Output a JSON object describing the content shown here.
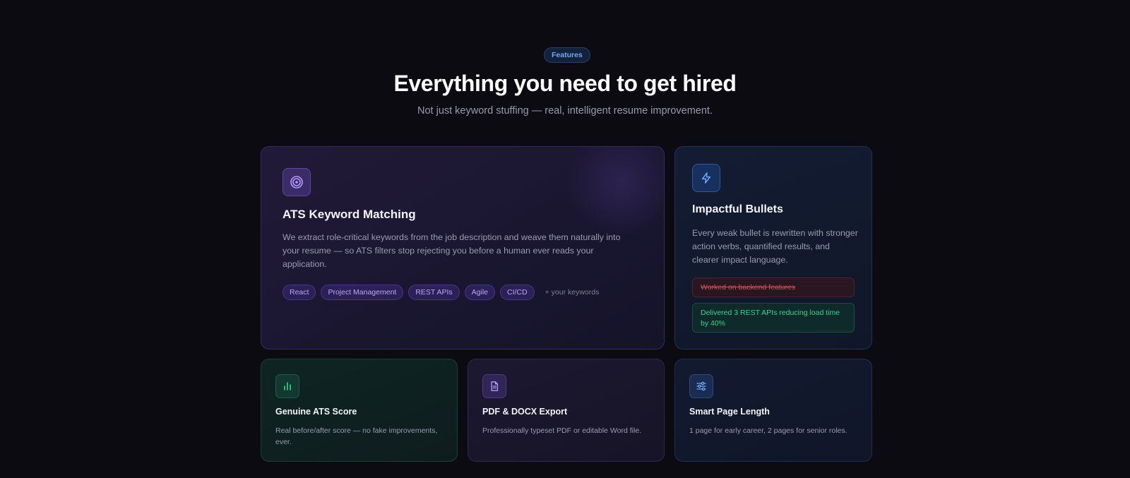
{
  "header": {
    "badge": "Features",
    "title": "Everything you need to get hired",
    "subtitle": "Not just keyword stuffing — real, intelligent resume improvement."
  },
  "cards": {
    "ats": {
      "icon": "target-icon",
      "title": "ATS Keyword Matching",
      "description": "We extract role-critical keywords from the job description and weave them naturally into your resume — so ATS filters stop rejecting you before a human ever reads your application.",
      "tags": [
        "React",
        "Project Management",
        "REST APIs",
        "Agile",
        "CI/CD"
      ],
      "extra": "+ your keywords"
    },
    "bullets": {
      "icon": "lightning-icon",
      "title": "Impactful Bullets",
      "description": "Every weak bullet is rewritten with stronger action verbs, quantified results, and clearer impact language.",
      "before": "Worked on backend features",
      "after": "Delivered 3 REST APIs reducing load time by 40%"
    },
    "score": {
      "icon": "bar-chart-icon",
      "title": "Genuine ATS Score",
      "description": "Real before/after score — no fake improvements, ever."
    },
    "export": {
      "icon": "document-icon",
      "title": "PDF & DOCX Export",
      "description": "Professionally typeset PDF or editable Word file."
    },
    "length": {
      "icon": "sliders-icon",
      "title": "Smart Page Length",
      "description": "1 page for early career, 2 pages for senior roles."
    }
  },
  "colors": {
    "background": "#0c0b12",
    "accent_purple": "#8b6cff",
    "accent_blue": "#5b9cff",
    "accent_green": "#3ed08e",
    "accent_red": "#d24e5c"
  }
}
